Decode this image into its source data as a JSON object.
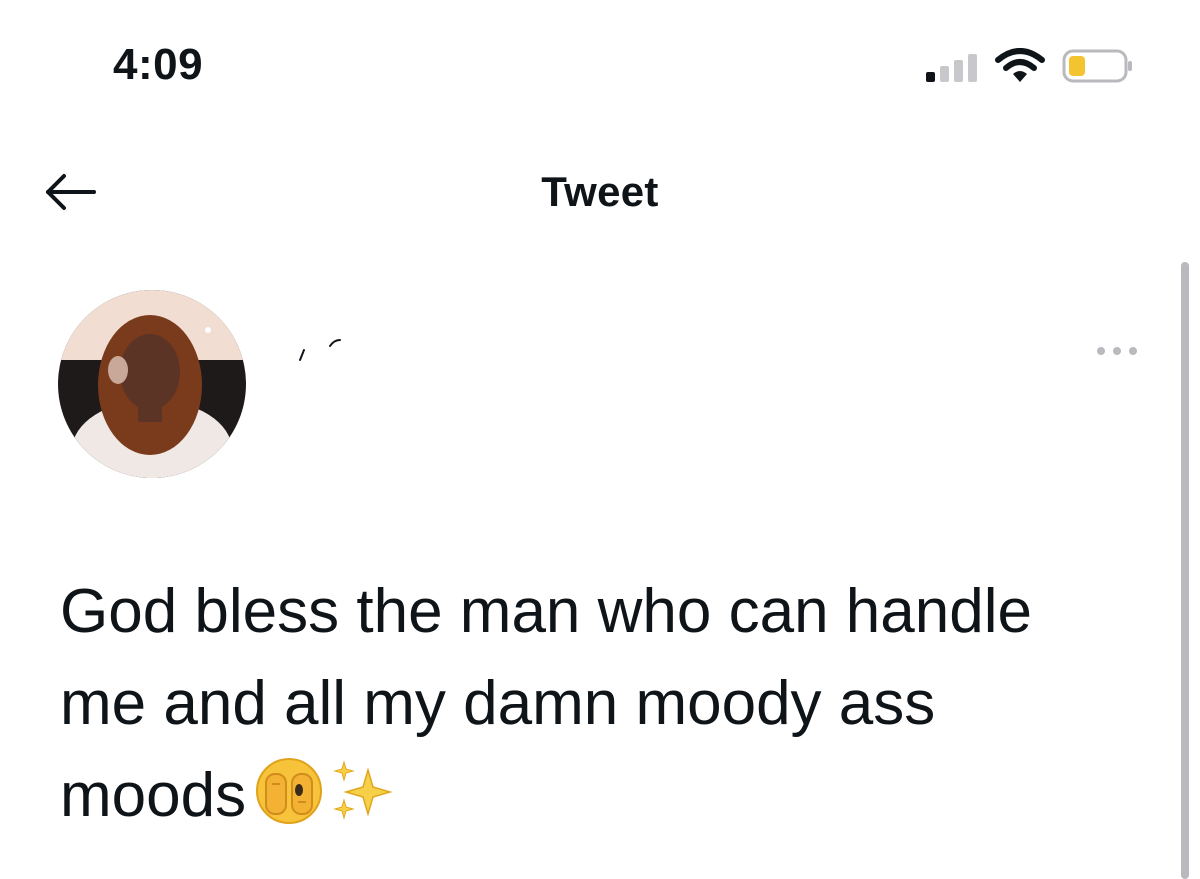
{
  "status_bar": {
    "time": "4:09",
    "icons": [
      "cellular-signal-icon",
      "wifi-icon",
      "battery-icon"
    ],
    "battery_level": 0.2,
    "battery_color": "#f4c430"
  },
  "header": {
    "title": "Tweet",
    "back_icon": "back-arrow-icon"
  },
  "author": {
    "more_icon": "more-options-icon"
  },
  "tweet": {
    "text": "God bless the man who can handle me and all my damn moody ass moods",
    "emojis": [
      "face-with-hand-over-mouth-emoji",
      "sparkles-emoji"
    ]
  },
  "colors": {
    "text": "#0f1419",
    "muted": "#b9b9be",
    "background": "#ffffff"
  }
}
